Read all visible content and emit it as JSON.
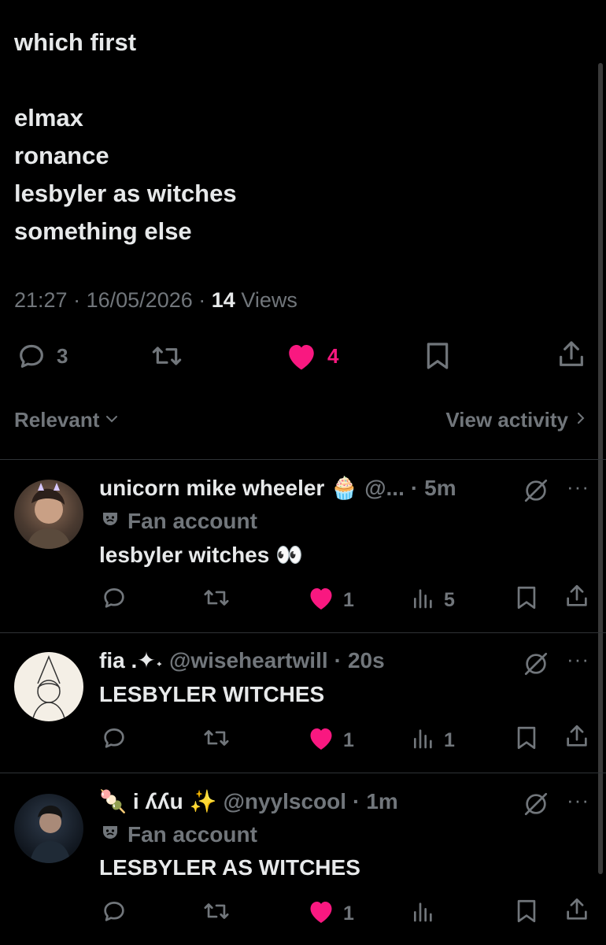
{
  "post": {
    "lines": [
      "which first",
      "",
      "elmax",
      "ronance",
      "lesbyler as witches",
      "something else"
    ],
    "time": "21:27",
    "sep": "·",
    "date": "16/05/2026",
    "views_count": "14",
    "views_label": "Views",
    "replies": "3",
    "likes": "4"
  },
  "tabs": {
    "sort": "Relevant",
    "activity": "View activity"
  },
  "replies": [
    {
      "name": "unicorn mike wheeler",
      "name_emoji": "🧁",
      "handle": "@...",
      "time": "5m",
      "fan": "Fan account",
      "text": "lesbyler witches",
      "text_emoji": "👀",
      "likes": "1",
      "views": "5"
    },
    {
      "name": "fia .✦˖",
      "handle": "@wiseheartwill",
      "time": "20s",
      "text": "LESBYLER WITCHES",
      "likes": "1",
      "views": "1"
    },
    {
      "name_prefix": "🍡",
      "name": "i ʎʎu",
      "name_emoji": "✨",
      "handle": "@nyylscool",
      "time": "1m",
      "fan": "Fan account",
      "text": "LESBYLER AS WITCHES",
      "likes": "1"
    }
  ],
  "colors": {
    "background": "#000000",
    "text": "#e7e9ea",
    "muted": "#71767b",
    "like": "#f91880",
    "divider": "#2f3336"
  }
}
